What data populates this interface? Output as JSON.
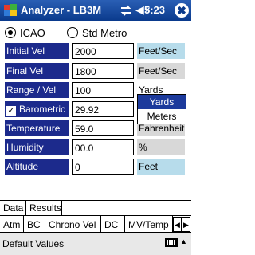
{
  "titlebar": {
    "title": "Analyzer - LB3M",
    "sync_icon": "sync-arrows-icon",
    "sound_icon": "speaker-icon",
    "speaker_glyph": "◀×",
    "time": "5:23",
    "ok_label": "✖"
  },
  "mode": {
    "options": [
      "ICAO",
      "Std Metro"
    ],
    "selected": "ICAO"
  },
  "rows": [
    {
      "label": "Initial Vel",
      "value": "2000",
      "unit": "Feet/Sec"
    },
    {
      "label": "Final Vel",
      "value": "1800",
      "unit": "Feet/Sec"
    },
    {
      "label": "Range / Vel",
      "value": "100",
      "unit": "Yards"
    },
    {
      "label": "Barometric",
      "checked": true,
      "value": "29.92",
      "unit": ""
    },
    {
      "label": "Temperature",
      "value": "59.0",
      "unit": "Fahrenheit"
    },
    {
      "label": "Humidity",
      "value": "00.0",
      "unit": "%"
    },
    {
      "label": "Altitude",
      "value": "0",
      "unit": "Feet"
    }
  ],
  "check_glyph": "✓",
  "range_unit_dropdown": {
    "options": [
      "Yards",
      "Meters"
    ],
    "selected": "Yards"
  },
  "main_tabs": [
    "Data",
    "Results"
  ],
  "sub_tabs": [
    "Atm",
    "BC",
    "Chrono Vel",
    "DC",
    "MV/Temp"
  ],
  "sub_tab_selected": "BC",
  "scroll": {
    "left": "◀",
    "right": "▶"
  },
  "bottom": {
    "menu_label": "Default Values",
    "keyboard_caret": "▲"
  }
}
